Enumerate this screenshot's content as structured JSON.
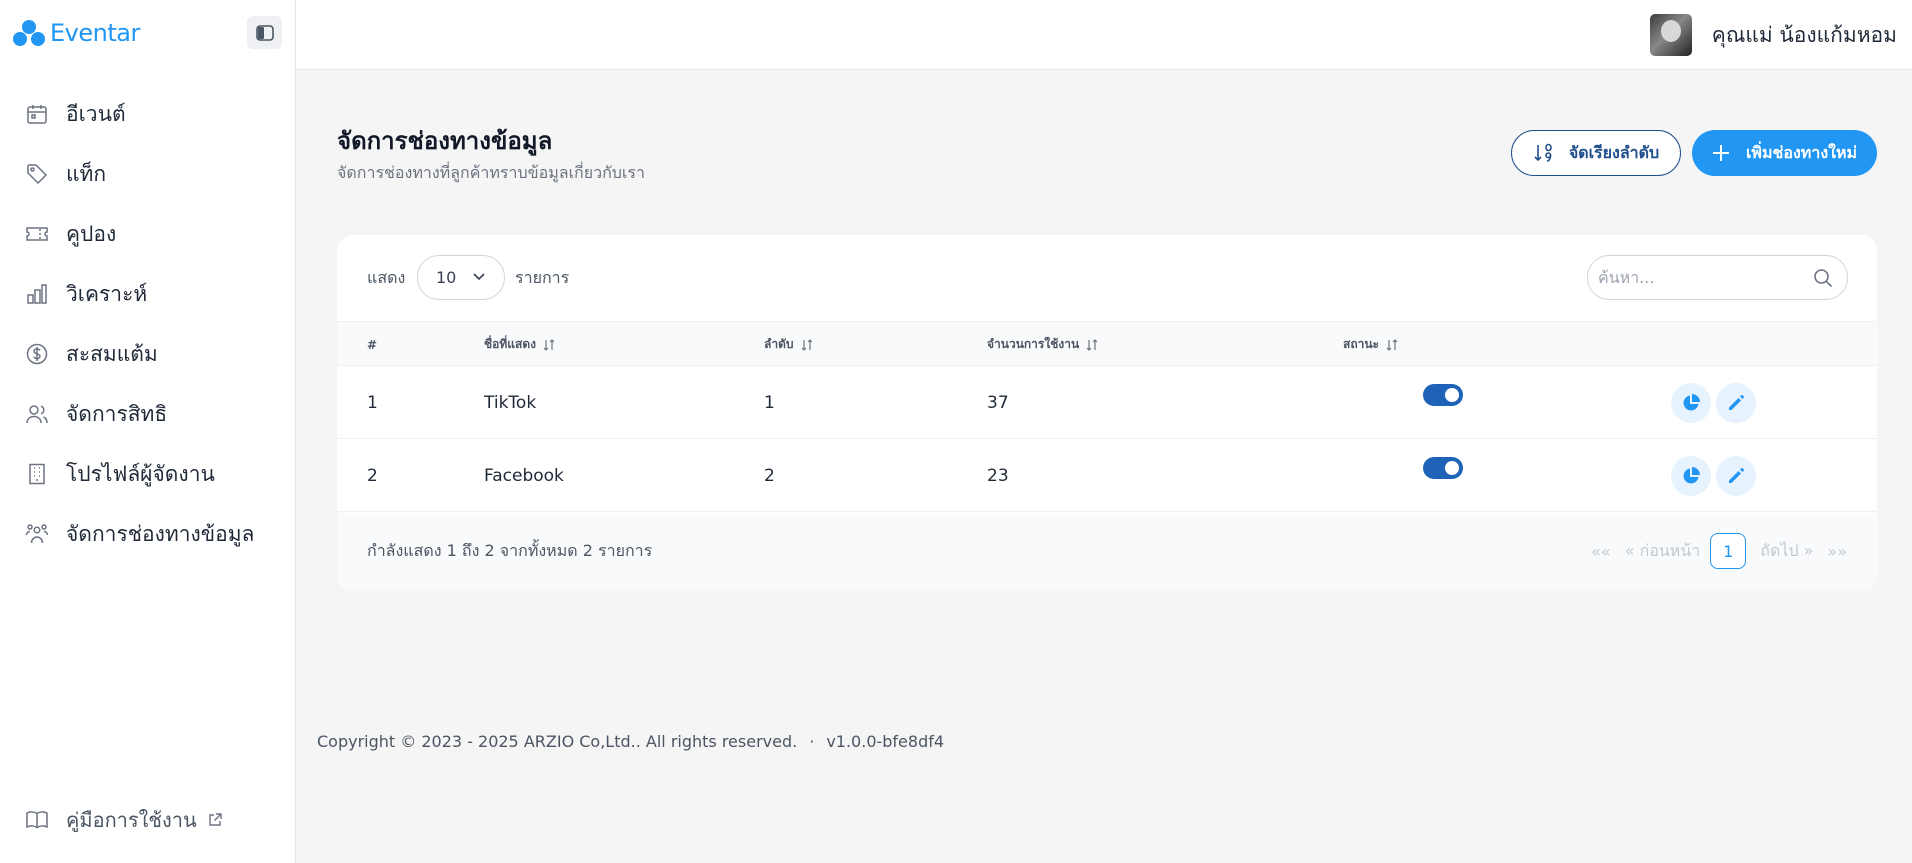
{
  "brand": {
    "name": "Eventar"
  },
  "sidebar": {
    "items": [
      {
        "label": "อีเวนต์",
        "icon": "calendar-icon"
      },
      {
        "label": "แท็ก",
        "icon": "tag-icon"
      },
      {
        "label": "คูปอง",
        "icon": "ticket-icon"
      },
      {
        "label": "วิเคราะห์",
        "icon": "bar-chart-icon"
      },
      {
        "label": "สะสมแต้ม",
        "icon": "dollar-icon"
      },
      {
        "label": "จัดการสิทธิ",
        "icon": "users-icon"
      },
      {
        "label": "โปรไฟล์ผู้จัดงาน",
        "icon": "building-icon"
      },
      {
        "label": "จัดการช่องทางข้อมูล",
        "icon": "group-icon"
      }
    ],
    "guide_label": "คู่มือการใช้งาน"
  },
  "header": {
    "user_name": "คุณแม่ น้องแก้มหอม"
  },
  "page": {
    "title": "จัดการช่องทางข้อมูล",
    "subtitle": "จัดการช่องทางที่ลูกค้าทราบข้อมูลเกี่ยวกับเรา",
    "sort_label": "จัดเรียงลำดับ",
    "add_label": "เพิ่มช่องทางใหม่"
  },
  "table": {
    "show_label": "แสดง",
    "page_size": "10",
    "items_label": "รายการ",
    "search_placeholder": "ค้นหา...",
    "columns": [
      "#",
      "ชื่อที่แสดง",
      "ลำดับ",
      "จำนวนการใช้งาน",
      "สถานะ"
    ],
    "rows": [
      {
        "no": "1",
        "name": "TikTok",
        "order": "1",
        "usage": "37",
        "active": true
      },
      {
        "no": "2",
        "name": "Facebook",
        "order": "2",
        "usage": "23",
        "active": true
      }
    ],
    "summary": "กำลังแสดง 1 ถึง 2 จากทั้งหมด 2 รายการ",
    "pager": {
      "first": "««",
      "prev": "« ก่อนหน้า",
      "current": "1",
      "next": "ถัดไป »",
      "last": "»»"
    }
  },
  "footer": {
    "copyright": "Copyright © 2023 - 2025 ARZIO Co,Ltd.. All rights reserved.",
    "separator": "·",
    "version": "v1.0.0-bfe8df4"
  },
  "colors": {
    "primary": "#2196f3",
    "dark_blue": "#1e4e8c",
    "toggle_on": "#1e63b8"
  }
}
